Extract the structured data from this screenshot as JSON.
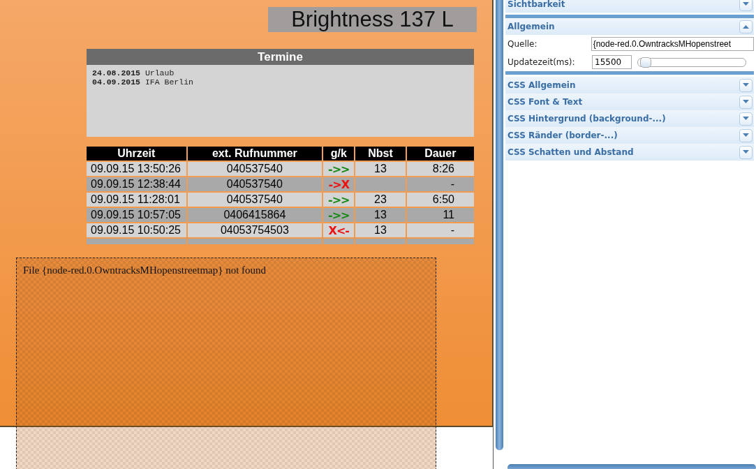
{
  "canvas": {
    "brightness": {
      "text": "Brightness 137 L"
    },
    "appointments": {
      "title": "Termine",
      "entries": [
        {
          "date": "24.08.2015",
          "text": "Urlaub"
        },
        {
          "date": "04.09.2015",
          "text": "IFA Berlin"
        }
      ]
    },
    "calls": {
      "columns": [
        "Uhrzeit",
        "ext. Rufnummer",
        "g/k",
        "Nbst",
        "Dauer"
      ],
      "rows": [
        {
          "time": "09.09.15 13:50:26",
          "number": "040537540",
          "direction": "->>",
          "kind": "connected",
          "extension": "13",
          "duration": "8:26"
        },
        {
          "time": "09.09.15 12:38:44",
          "number": "040537540",
          "direction": "->X",
          "kind": "failed",
          "duration": "-"
        },
        {
          "time": "09.09.15 11:28:01",
          "number": "040537540",
          "direction": "->>",
          "kind": "connected",
          "extension": "23",
          "duration": "6:50"
        },
        {
          "time": "09.09.15 10:57:05",
          "number": "0406415864",
          "direction": "->>",
          "kind": "connected",
          "extension": "13",
          "duration": "11"
        },
        {
          "time": "09.09.15 10:50:25",
          "number": "04053754503",
          "direction": "X<-",
          "kind": "failed",
          "extension": "13",
          "duration": "-"
        }
      ]
    },
    "missing_widget": {
      "message": "File {node-red.0.OwntracksMHopenstreetmap} not found"
    }
  },
  "properties": {
    "sections": [
      {
        "title": "Sichtbarkeit",
        "expanded": false
      },
      {
        "title": "Allgemein",
        "expanded": true,
        "fields": [
          {
            "kind": "text",
            "label": "Quelle:",
            "value": "{node-red.0.OwntracksMHopenstreet"
          },
          {
            "kind": "slider",
            "label": "Updatezeit(ms):",
            "value": "15500",
            "level": 0.02
          }
        ]
      },
      {
        "title": "CSS Allgemein",
        "expanded": false
      },
      {
        "title": "CSS Font & Text",
        "expanded": false
      },
      {
        "title": "CSS Hintergrund (background-...)",
        "expanded": false
      },
      {
        "title": "CSS Ränder (border-...)",
        "expanded": false
      },
      {
        "title": "CSS Schatten und Abstand",
        "expanded": false
      }
    ]
  }
}
